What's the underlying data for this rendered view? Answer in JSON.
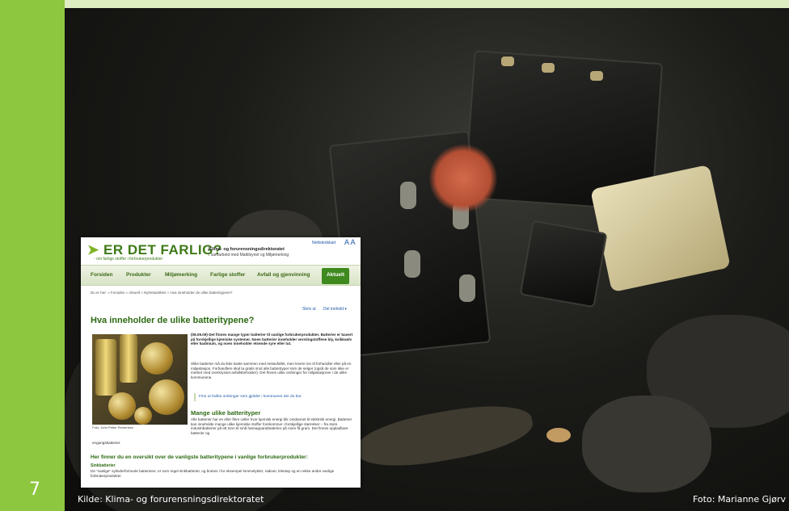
{
  "slide": {
    "number": "7",
    "source_caption": "Kilde: Klima- og forurensningsdirektoratet",
    "photo_credit": "Foto: Marianne Gjørv"
  },
  "website": {
    "logo_text": "ER DET FARLIG?",
    "tagline": "- om farlige stoffer i forbrukerprodukter",
    "agency": "Klima- og forurensningsdirektoratet",
    "cooperation": "I samarbeid med Mattilsynet og Miljømerking",
    "sitemap_link": "Nettstedskart",
    "text_size": "A A",
    "nav": [
      "Forsiden",
      "Produkter",
      "Miljømerking",
      "Farlige stoffer",
      "Avfall og gjenvinning"
    ],
    "nav_active": "Aktuelt",
    "breadcrumb": "Du er her: » Forsiden » Aktuelt » Nyhetsartikler » Hva inneholder de ulike batteritypene?",
    "print_link": "Skriv ut",
    "share_link": "Del innhold ▾",
    "title": "Hva inneholder de ulike batteritypene?",
    "lead": "(08.09.09) Det finnes mange typer batterier til vanlige forbrukerprodukter. Batterier er basert på forskjellige kjemiske systemer. Noen batterier inneholder verstingstoffene bly, kvikksølv eller kadmium, og noen inneholder etsende syre eller lut.",
    "body": "Slike batterier må du ikke kaste sammen med restavfallet, men levere inn til forhandler eller på en miljøstasjon. Forhandlere skal ta gratis imot alle batterityper som de selger (også de som ikke er merket med overkrysset avfallsbeholder). Det finnes ulike ordninger for miljøstasjoner i de ulike kommunene.",
    "box_link": "Finn ut hvilke ordninger som gjelder i kommunen der du bor.",
    "image_caption": "Foto: John Petter Reinertsen",
    "h2": "Mange ulike batterityper",
    "body2": "Alle batterier har en eller flere celler hvor kjemisk energi blir omdannet til elektrisk energi. Batterier kan inneholde mange ulike kjemiske stoffer forekommer i forskjellige størrelser – fra store industribatterier på ett tonn til små høreapparatbatterier på noen få gram. Det finnes oppladbare batterier og",
    "body2_cont": "engangsbatterier.",
    "h2b": "Her finner du en oversikt over de vanligste batteritypene i vanlige forbrukerprodukter:",
    "h3": "Sinkbatterier",
    "body3": "De \"vanlige\" sylinderformede batteriene, er som regel sinkbatterier, og brukes i for eksempel lommelykter, radioer, leketøy og en rekke andre vanlige forbrukerprodukter."
  }
}
